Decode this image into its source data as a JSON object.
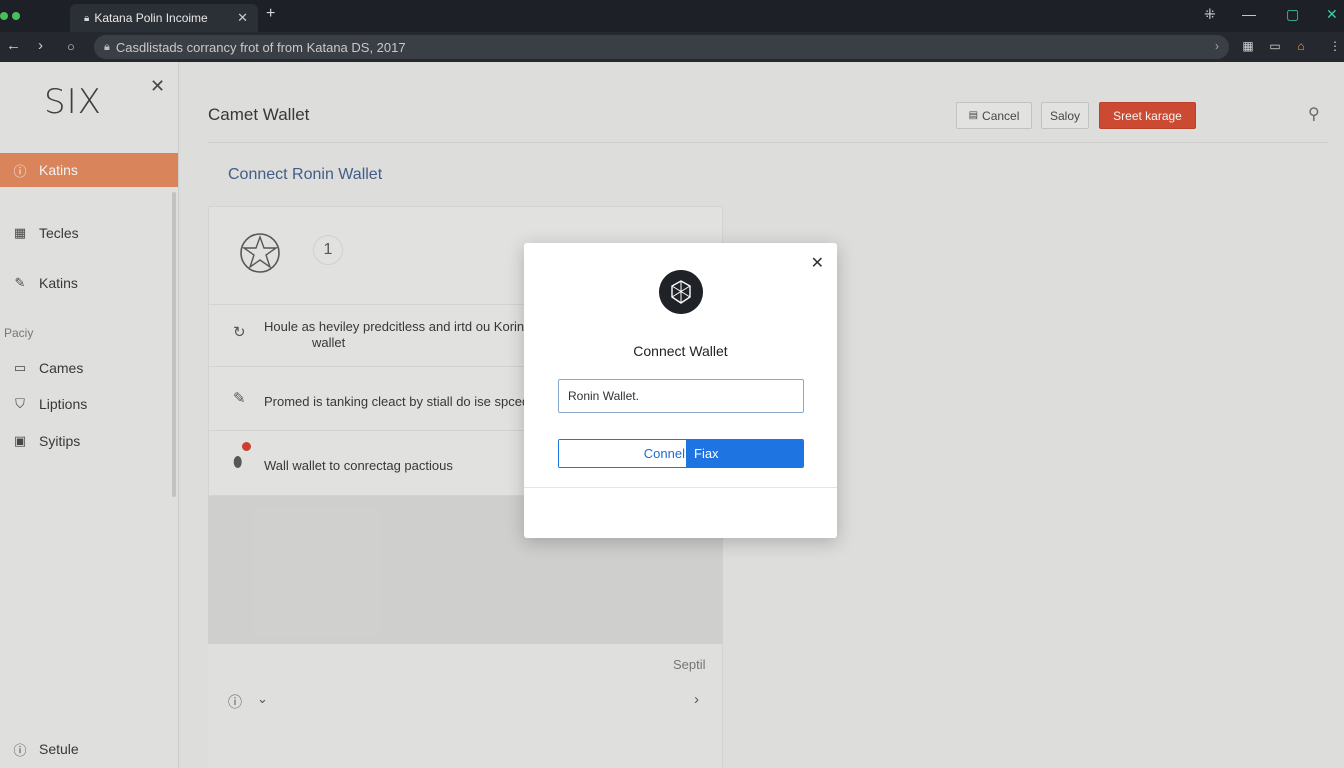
{
  "browser": {
    "tab_title": "Katana Polin Incoime",
    "url": "Casdlistads corrancy frot of from Katana DS, 2017",
    "new_tab": "+",
    "tab_close": "✕"
  },
  "sidebar": {
    "logo": "SIX",
    "items": [
      {
        "label": "Katins",
        "icon": "info-icon"
      },
      {
        "label": "Tecles",
        "icon": "grid-icon"
      },
      {
        "label": "Katins",
        "icon": "edit-icon"
      },
      {
        "label": "Cames",
        "icon": "monitor-icon"
      },
      {
        "label": "Liptions",
        "icon": "shield-icon"
      },
      {
        "label": "Syitips",
        "icon": "settings-icon"
      }
    ],
    "section_label": "Paciy",
    "footer": {
      "label": "Setule",
      "icon": "info-icon"
    }
  },
  "header": {
    "title": "Camet Wallet",
    "buttons": {
      "cancel": "Cancel",
      "save": "Saloy",
      "primary": "Sreet karage"
    }
  },
  "main": {
    "subtitle": "Connect Ronin Wallet",
    "badge": "1",
    "rows": [
      {
        "text": "Houle as heviley predcitless and irtd ou Korina",
        "text2": "wallet"
      },
      {
        "text": "Promed is tanking cleact by stiall do ise spced"
      },
      {
        "text": "Wall wallet to conrectag pactious"
      }
    ],
    "footer_label": "Septil"
  },
  "modal": {
    "title": "Connect Wallet",
    "input_value": "Ronin Wallet.",
    "button_left": "Connel",
    "button_right": "Fiax"
  },
  "colors": {
    "accent": "#e2865a",
    "primary_button": "#d4472c",
    "link": "#3d5c8a",
    "connect_blue": "#1e74e0"
  }
}
